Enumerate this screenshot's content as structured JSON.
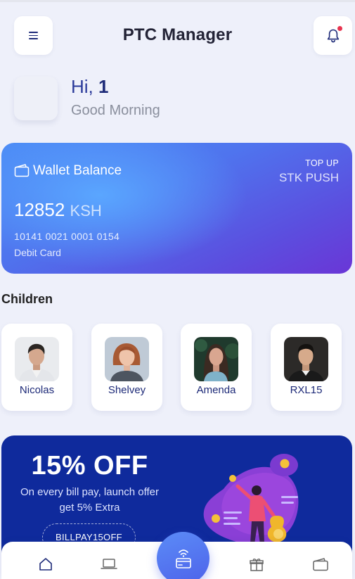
{
  "header": {
    "title": "PTC Manager"
  },
  "greeting": {
    "hi": "Hi,",
    "name": "1",
    "subtitle": "Good Morning"
  },
  "wallet": {
    "label": "Wallet Balance",
    "topup_label": "TOP UP",
    "topup_method": "STK PUSH",
    "balance": "12852",
    "currency": "KSH",
    "card_number": "10141 0021 0001 0154",
    "card_type": "Debit Card"
  },
  "children": {
    "title": "Children",
    "items": [
      {
        "name": "Nicolas"
      },
      {
        "name": "Shelvey"
      },
      {
        "name": "Amenda"
      },
      {
        "name": "RXL15"
      }
    ]
  },
  "promo": {
    "title": "15% OFF",
    "line1": "On every bill pay, launch offer",
    "line2": "get 5% Extra",
    "code": "BILLPAY15OFF"
  },
  "nav": {
    "icons": [
      "home-icon",
      "laptop-icon",
      "contactless-card-icon",
      "gift-icon",
      "wallet-icon"
    ]
  },
  "colors": {
    "primary": "#1d2a78",
    "promo_bg": "#0f2a9c",
    "notification": "#e8334f",
    "card_gradient_start": "#4c8cf6",
    "card_gradient_end": "#6a36d6"
  }
}
